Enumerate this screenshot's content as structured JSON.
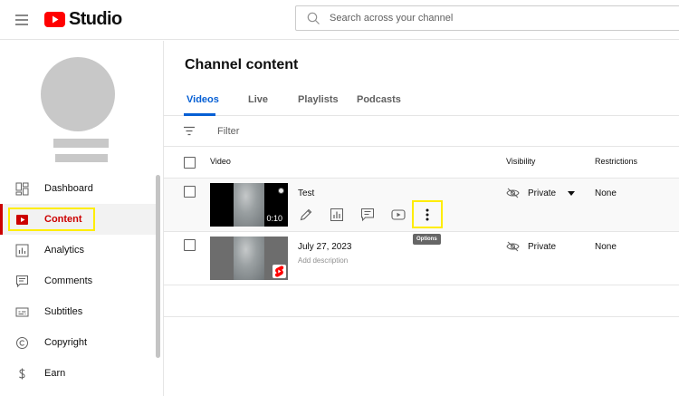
{
  "header": {
    "logo_text": "Studio",
    "search_placeholder": "Search across your channel",
    "icons": {
      "menu": "hamburger-menu-icon",
      "search": "search-icon",
      "logo": "youtube-logo-icon"
    }
  },
  "sidebar": {
    "items": [
      {
        "label": "Dashboard",
        "icon": "dashboard-icon",
        "active": false
      },
      {
        "label": "Content",
        "icon": "content-icon",
        "active": true
      },
      {
        "label": "Analytics",
        "icon": "analytics-icon",
        "active": false
      },
      {
        "label": "Comments",
        "icon": "comments-icon",
        "active": false
      },
      {
        "label": "Subtitles",
        "icon": "subtitles-icon",
        "active": false
      },
      {
        "label": "Copyright",
        "icon": "copyright-icon",
        "active": false
      },
      {
        "label": "Earn",
        "icon": "earn-icon",
        "active": false
      }
    ]
  },
  "main": {
    "title": "Channel content",
    "tabs": [
      {
        "label": "Videos",
        "active": true
      },
      {
        "label": "Live",
        "active": false
      },
      {
        "label": "Playlists",
        "active": false
      },
      {
        "label": "Podcasts",
        "active": false
      }
    ],
    "filter_placeholder": "Filter",
    "columns": {
      "video": "Video",
      "visibility": "Visibility",
      "restrictions": "Restrictions"
    },
    "rows": [
      {
        "title": "Test",
        "duration": "0:10",
        "visibility": "Private",
        "restrictions": "None",
        "actions": [
          "edit-icon",
          "analytics-icon",
          "comments-icon",
          "youtube-play-icon",
          "more-options-icon"
        ],
        "tooltip": "Options"
      },
      {
        "title": "July 27, 2023",
        "description": "Add description",
        "visibility": "Private",
        "restrictions": "None"
      }
    ]
  },
  "colors": {
    "accent_blue": "#065fd4",
    "brand_red": "#cc0000",
    "highlight_yellow": "#ffed00"
  }
}
